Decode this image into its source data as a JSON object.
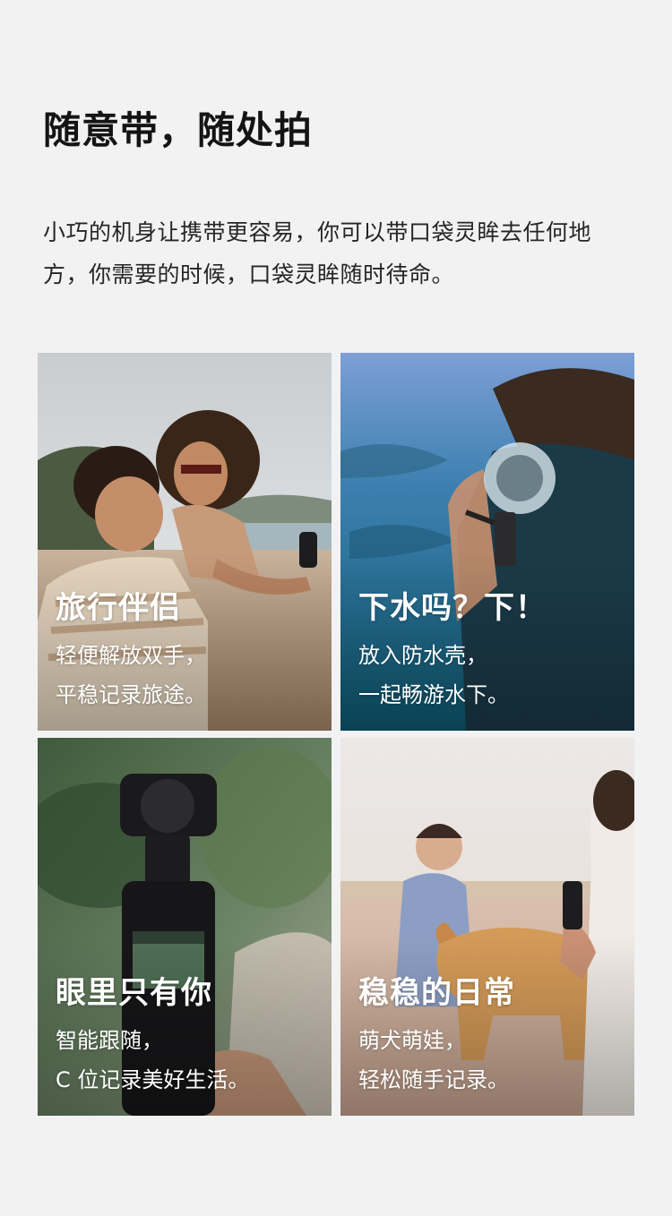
{
  "header": {
    "title": "随意带，随处拍",
    "intro": "小巧的机身让携带更容易，你可以带口袋灵眸去任何地方，你需要的时候，口袋灵眸随时待命。"
  },
  "cards": [
    {
      "title": "旅行伴侣",
      "desc_line1": "轻便解放双手，",
      "desc_line2": "平稳记录旅途。",
      "image": "beach-couple-photo"
    },
    {
      "title": "下水吗？下！",
      "desc_line1": "放入防水壳，",
      "desc_line2": "一起畅游水下。",
      "image": "underwater-diver-photo"
    },
    {
      "title": "眼里只有你",
      "desc_line1": "智能跟随，",
      "desc_line2": "C 位记录美好生活。",
      "image": "gimbal-camera-closeup-photo"
    },
    {
      "title": "稳稳的日常",
      "desc_line1": "萌犬萌娃，",
      "desc_line2": "轻松随手记录。",
      "image": "girl-and-dog-photo"
    }
  ],
  "colors": {
    "background": "#f2f2f3",
    "text": "#1b1b1b",
    "card_text": "#ffffff"
  }
}
